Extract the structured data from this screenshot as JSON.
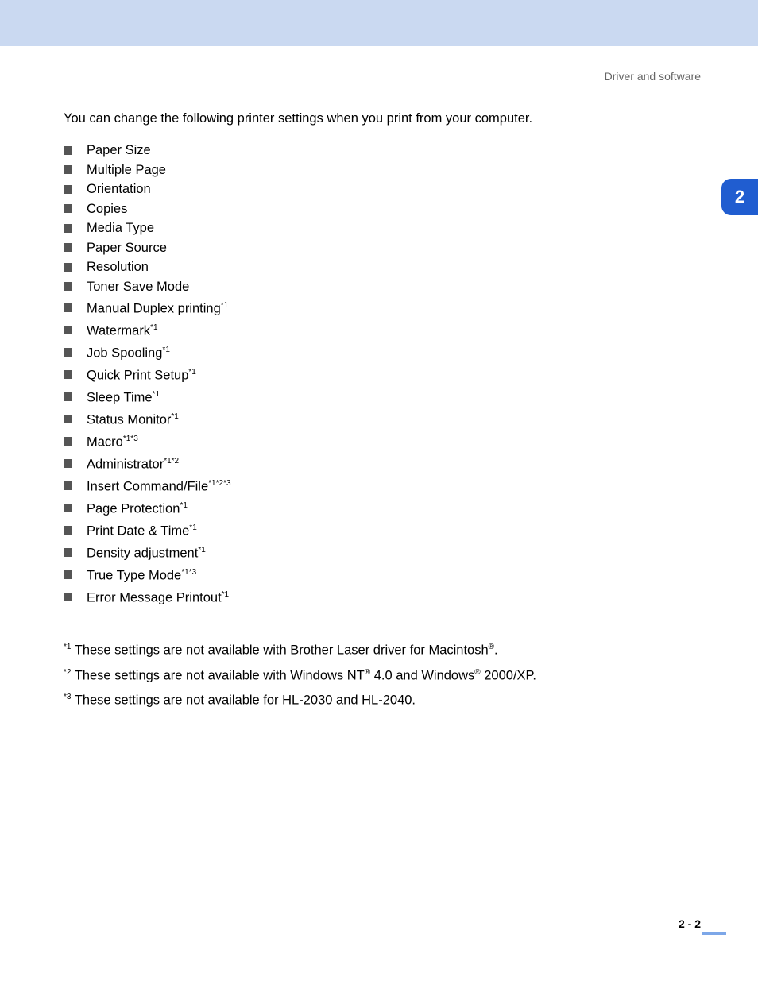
{
  "header": "Driver and software",
  "intro": "You can change the following printer settings when you print from your computer.",
  "settings": [
    {
      "label": "Paper Size",
      "sup": ""
    },
    {
      "label": "Multiple Page",
      "sup": ""
    },
    {
      "label": "Orientation",
      "sup": ""
    },
    {
      "label": "Copies",
      "sup": ""
    },
    {
      "label": "Media Type",
      "sup": ""
    },
    {
      "label": "Paper Source",
      "sup": ""
    },
    {
      "label": "Resolution",
      "sup": ""
    },
    {
      "label": "Toner Save Mode",
      "sup": ""
    },
    {
      "label": "Manual Duplex printing",
      "sup": "*1"
    },
    {
      "label": "Watermark",
      "sup": "*1"
    },
    {
      "label": "Job Spooling",
      "sup": "*1"
    },
    {
      "label": "Quick Print Setup",
      "sup": "*1"
    },
    {
      "label": "Sleep Time",
      "sup": "*1"
    },
    {
      "label": "Status Monitor",
      "sup": "*1"
    },
    {
      "label": "Macro",
      "sup": "*1*3"
    },
    {
      "label": "Administrator",
      "sup": "*1*2"
    },
    {
      "label": "Insert Command/File",
      "sup": "*1*2*3"
    },
    {
      "label": "Page Protection",
      "sup": "*1"
    },
    {
      "label": "Print Date & Time",
      "sup": "*1"
    },
    {
      "label": "Density adjustment",
      "sup": "*1"
    },
    {
      "label": "True Type Mode",
      "sup": "*1*3"
    },
    {
      "label": "Error Message Printout",
      "sup": "*1"
    }
  ],
  "footnotes": [
    {
      "sup": "*1",
      "pre": " These settings are not available with Brother Laser driver for Macintosh",
      "reg": "®",
      "post": "."
    },
    {
      "sup": "*2",
      "pre": " These settings are not available with Windows NT",
      "reg": "®",
      "mid": " 4.0 and Windows",
      "reg2": "®",
      "post": " 2000/XP."
    },
    {
      "sup": "*3",
      "pre": " These settings are not available for HL-2030 and HL-2040.",
      "reg": "",
      "post": ""
    }
  ],
  "chapter_tab": "2",
  "page_number": "2 - 2"
}
